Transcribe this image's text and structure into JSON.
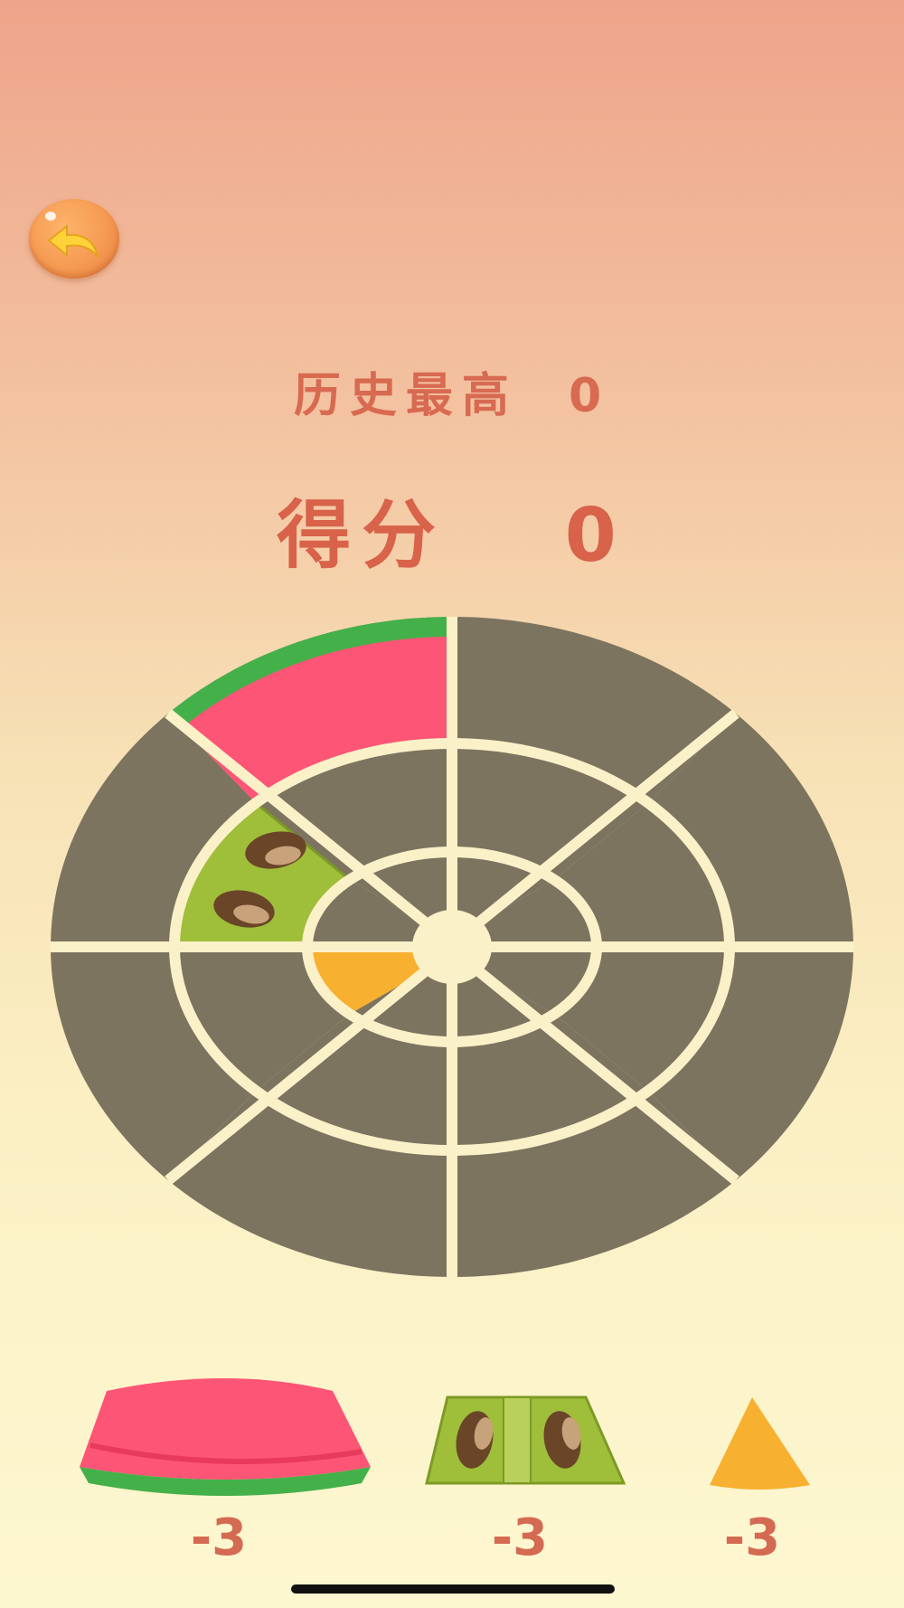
{
  "header": {
    "best_label": "历史最高",
    "best_value": "0",
    "score_label": "得分",
    "score_value": "0"
  },
  "board": {
    "rings": 3,
    "sectors": 8,
    "placed_pieces": [
      {
        "type": "watermelon",
        "ring": "outer",
        "sector": "top-left"
      },
      {
        "type": "kiwi",
        "ring": "middle",
        "sector": "left-upper"
      },
      {
        "type": "orange",
        "ring": "inner",
        "sector": "left-lower"
      }
    ]
  },
  "tray": [
    {
      "type": "watermelon",
      "count": "-3"
    },
    {
      "type": "kiwi",
      "count": "-3"
    },
    {
      "type": "orange",
      "count": "-3"
    }
  ],
  "colors": {
    "empty_slot": "#7c745f",
    "grid_line": "#fbf1c9",
    "watermelon_flesh": "#fd5575",
    "watermelon_rind": "#44b04a",
    "kiwi": "#9fbe3a",
    "orange": "#f8b030",
    "text": "#d8624a",
    "back_button": "#f59a52"
  },
  "icons": [
    "back-arrow-icon"
  ]
}
